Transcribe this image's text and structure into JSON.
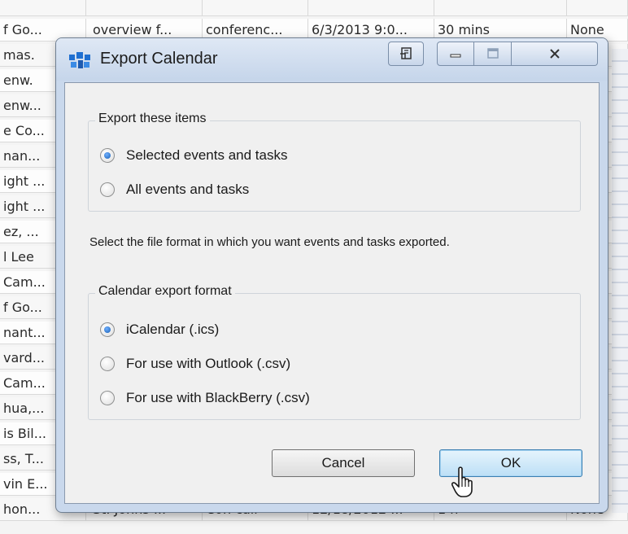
{
  "background_table": {
    "rows": [
      {
        "c0": "",
        "c1": "",
        "c2": "",
        "c3": "",
        "c4": "",
        "c5": ""
      },
      {
        "c0": "f Go...",
        "c1": "overview f...",
        "c2": "conferenc...",
        "c3": "6/3/2013  9:0...",
        "c4": "30 mins",
        "c5": "None"
      },
      {
        "c0": "mas.",
        "c1": "",
        "c2": "",
        "c3": "",
        "c4": "",
        "c5": ""
      },
      {
        "c0": "enw.",
        "c1": "",
        "c2": "",
        "c3": "",
        "c4": "",
        "c5": ""
      },
      {
        "c0": "enw...",
        "c1": "",
        "c2": "",
        "c3": "",
        "c4": "",
        "c5": ""
      },
      {
        "c0": "e Co...",
        "c1": "",
        "c2": "",
        "c3": "",
        "c4": "",
        "c5": ""
      },
      {
        "c0": "nan...",
        "c1": "",
        "c2": "",
        "c3": "",
        "c4": "",
        "c5": ""
      },
      {
        "c0": "ight ...",
        "c1": "",
        "c2": "",
        "c3": "",
        "c4": "",
        "c5": ""
      },
      {
        "c0": "ight ...",
        "c1": "",
        "c2": "",
        "c3": "",
        "c4": "",
        "c5": ""
      },
      {
        "c0": "ez, ...",
        "c1": "",
        "c2": "",
        "c3": "",
        "c4": "",
        "c5": ""
      },
      {
        "c0": "l Lee",
        "c1": "",
        "c2": "",
        "c3": "",
        "c4": "",
        "c5": ""
      },
      {
        "c0": "Cam...",
        "c1": "",
        "c2": "",
        "c3": "",
        "c4": "",
        "c5": ""
      },
      {
        "c0": "f Go...",
        "c1": "",
        "c2": "",
        "c3": "",
        "c4": "",
        "c5": ""
      },
      {
        "c0": "nant...",
        "c1": "",
        "c2": "",
        "c3": "",
        "c4": "",
        "c5": ""
      },
      {
        "c0": "vard...",
        "c1": "",
        "c2": "",
        "c3": "",
        "c4": "",
        "c5": ""
      },
      {
        "c0": "Cam...",
        "c1": "",
        "c2": "",
        "c3": "",
        "c4": "",
        "c5": ""
      },
      {
        "c0": "hua,...",
        "c1": "",
        "c2": "",
        "c3": "",
        "c4": "",
        "c5": ""
      },
      {
        "c0": "is Bil...",
        "c1": "",
        "c2": "",
        "c3": "",
        "c4": "",
        "c5": ""
      },
      {
        "c0": "ss, T...",
        "c1": "",
        "c2": "",
        "c3": "",
        "c4": "",
        "c5": ""
      },
      {
        "c0": "vin E...",
        "c1": "",
        "c2": "",
        "c3": "",
        "c4": "",
        "c5": ""
      },
      {
        "c0": "hon...",
        "c1": "St. Johns ...",
        "c2": "Con call",
        "c3": "12/18/2012  ...",
        "c4": "1 h",
        "c5": "None"
      }
    ]
  },
  "dialog": {
    "title": "Export Calendar",
    "export_items": {
      "legend": "Export these items",
      "options": [
        {
          "label": "Selected events and tasks",
          "checked": true
        },
        {
          "label": "All events and tasks",
          "checked": false
        }
      ]
    },
    "description": "Select the file format in which you want events and tasks exported.",
    "format_group": {
      "legend": "Calendar export format",
      "options": [
        {
          "label": "iCalendar (.ics)",
          "checked": true
        },
        {
          "label": "For use with Outlook (.csv)",
          "checked": false
        },
        {
          "label": "For use with BlackBerry (.csv)",
          "checked": false
        }
      ]
    },
    "buttons": {
      "cancel": "Cancel",
      "ok": "OK"
    }
  },
  "colors": {
    "title_bar": "#c5d5ea",
    "client_bg": "#f0f0f0",
    "ok_button": "#bcdff6",
    "radio_dot": "#1a5fb4"
  },
  "icons": {
    "app": "app-icon",
    "restore": "restore-icon",
    "minimize": "minimize-icon",
    "maximize": "maximize-icon",
    "close": "close-icon",
    "cursor": "hand-cursor-icon"
  }
}
